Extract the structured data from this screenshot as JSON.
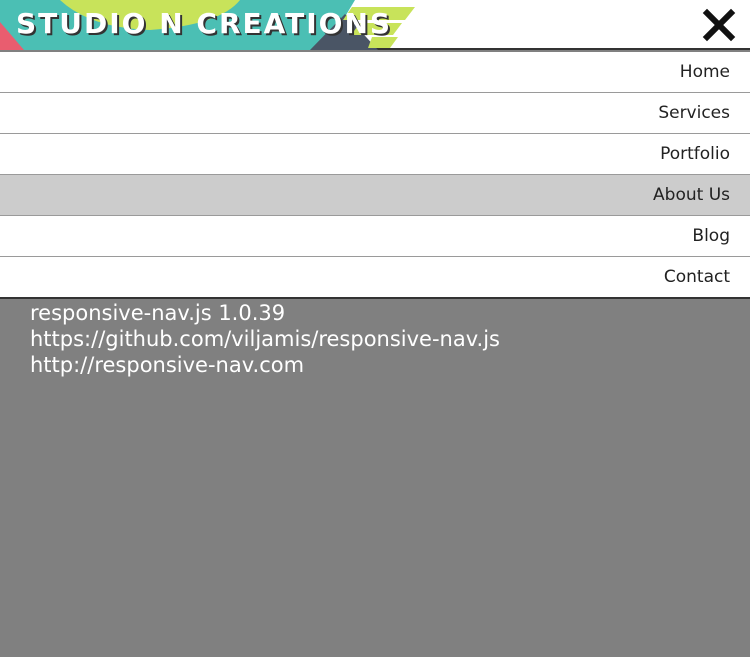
{
  "header": {
    "logo_text": "STUDIO N CREATIONS",
    "close_icon": "close-x-icon",
    "banner_colors": {
      "teal": "#4bbfb4",
      "yellow_green": "#c8e35a",
      "pink": "#e95d6f",
      "slate": "#3e4a5a"
    }
  },
  "nav": {
    "items": [
      {
        "label": "Home",
        "active": false
      },
      {
        "label": "Services",
        "active": false
      },
      {
        "label": "Portfolio",
        "active": false
      },
      {
        "label": "About Us",
        "active": true
      },
      {
        "label": "Blog",
        "active": false
      },
      {
        "label": "Contact",
        "active": false
      }
    ]
  },
  "info": {
    "lines": [
      "responsive-nav.js 1.0.39",
      "https://github.com/viljamis/responsive-nav.js",
      "http://responsive-nav.com"
    ]
  }
}
